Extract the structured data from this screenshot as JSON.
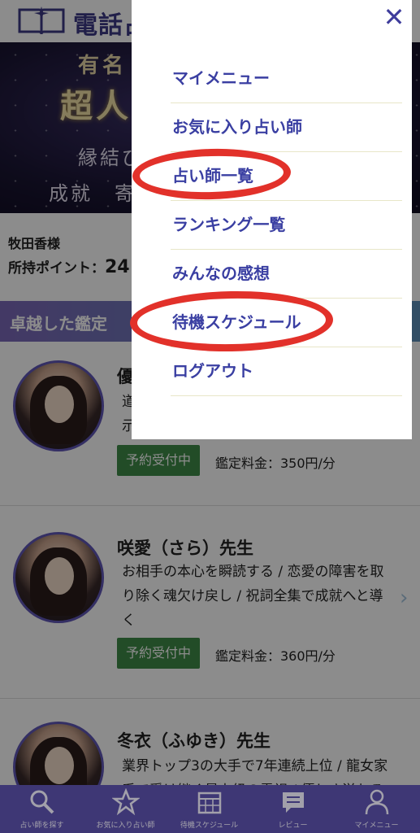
{
  "header": {
    "logo_text": "電話占い"
  },
  "banner": {
    "line1": "有名",
    "line2": "超人",
    "line3": "縁結び",
    "line4": "成就　寄"
  },
  "user": {
    "name": "牧田香様",
    "points_label": "所持ポイント：",
    "points_value": "24"
  },
  "section": {
    "title": "卓越した鑑定"
  },
  "cards": [
    {
      "name": "優",
      "desc_line1": "道",
      "desc_line2": "示",
      "badge": "予約受付中",
      "fee": "鑑定料金：350円/分"
    },
    {
      "name": "咲愛（さら）先生",
      "desc_line1": "お相手の本心を瞬読する / 恋愛の障害を取",
      "desc_line2": "り除く魂欠け戻し / 祝詞全集で成就へと導",
      "desc_line3": "く",
      "badge": "予約受付中",
      "fee": "鑑定料金：360円/分"
    },
    {
      "name": "冬衣（ふゆき）先生",
      "desc_line1": "業界トップ3の大手で7年連続上位 / 龍女家",
      "desc_line2": "系で受け継ぐ最上級の霊視 / 優しさ溢れる"
    }
  ],
  "menu": {
    "close_icon": "close-icon",
    "items": [
      {
        "label": "マイメニュー"
      },
      {
        "label": "お気に入り占い師"
      },
      {
        "label": "占い師一覧"
      },
      {
        "label": "ランキング一覧"
      },
      {
        "label": "みんなの感想"
      },
      {
        "label": "待機スケジュール"
      },
      {
        "label": "ログアウト"
      }
    ]
  },
  "nav": {
    "items": [
      {
        "label": "占い師を探す",
        "icon": "search-icon"
      },
      {
        "label": "お気に入り占い師",
        "icon": "star-icon"
      },
      {
        "label": "待機スケジュール",
        "icon": "calendar-icon"
      },
      {
        "label": "レビュー",
        "icon": "chat-icon"
      },
      {
        "label": "マイメニュー",
        "icon": "person-icon"
      }
    ]
  },
  "colors": {
    "accent": "#3a3fa2",
    "annotation": "#e2312a",
    "badge": "#3f8a48",
    "nav": "#5a4fa8"
  }
}
